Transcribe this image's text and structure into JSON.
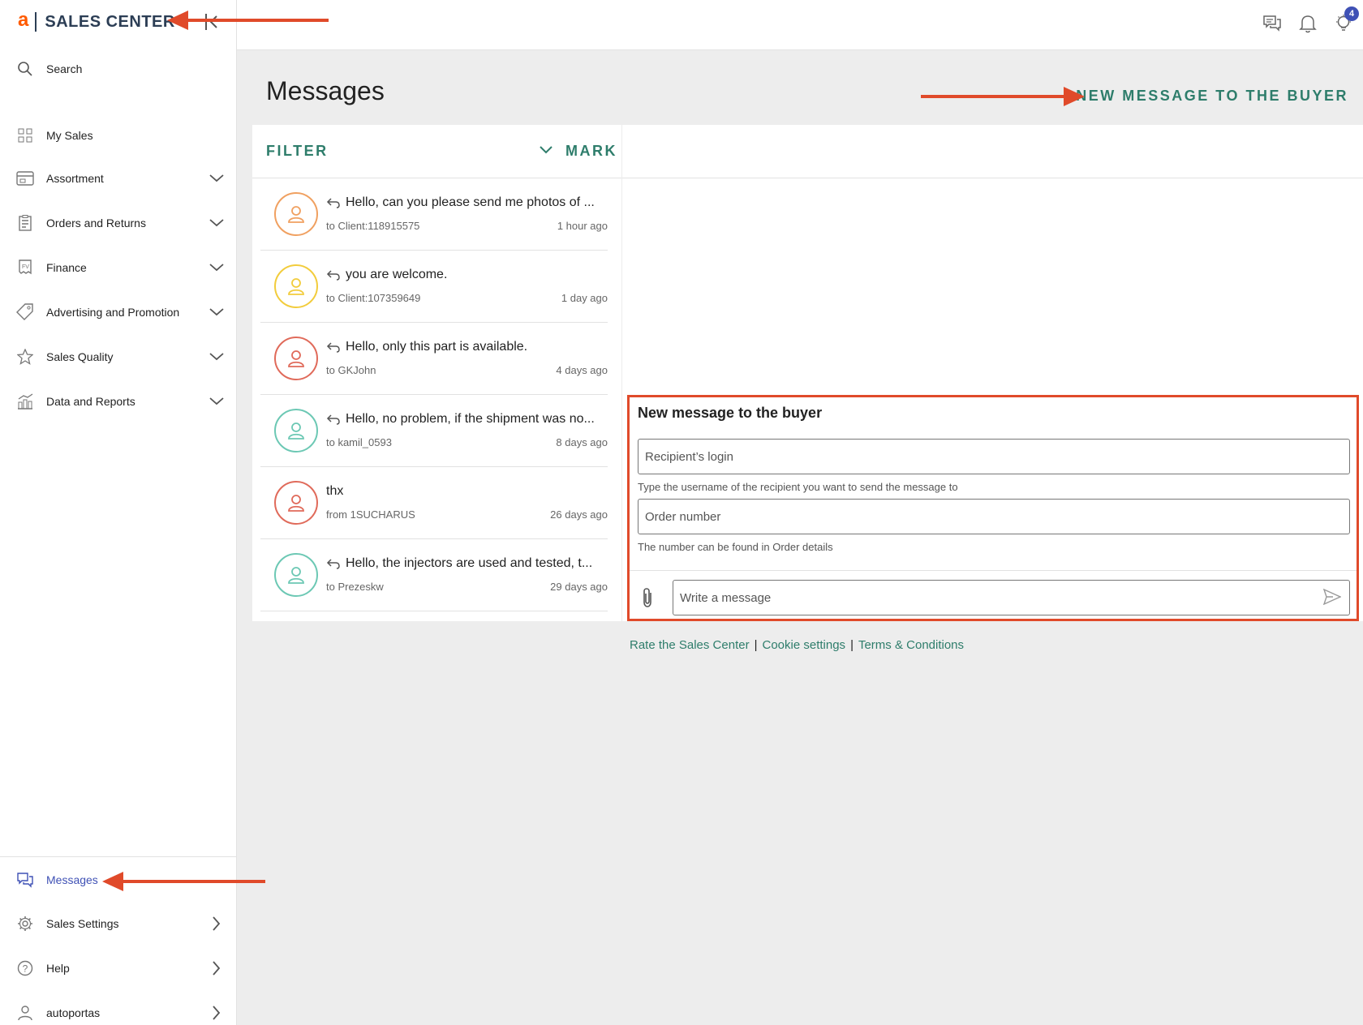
{
  "brand": {
    "logo_letter": "a",
    "name": "SALES CENTER",
    "accent": "#ff5a00",
    "primary": "#2c3e55"
  },
  "sidebar": {
    "search_label": "Search",
    "items": [
      {
        "label": "My Sales",
        "icon": "grid-icon",
        "expandable": false
      },
      {
        "label": "Assortment",
        "icon": "storefront-icon",
        "expandable": true
      },
      {
        "label": "Orders and Returns",
        "icon": "clipboard-icon",
        "expandable": true
      },
      {
        "label": "Finance",
        "icon": "invoice-icon",
        "expandable": true
      },
      {
        "label": "Advertising and Promotion",
        "icon": "tag-icon",
        "expandable": true
      },
      {
        "label": "Sales Quality",
        "icon": "star-icon",
        "expandable": true
      },
      {
        "label": "Data and Reports",
        "icon": "chart-icon",
        "expandable": true
      }
    ],
    "bottom_items": [
      {
        "label": "Messages",
        "icon": "chat-icon",
        "active": true
      },
      {
        "label": "Sales Settings",
        "icon": "gear-icon",
        "active": false
      },
      {
        "label": "Help",
        "icon": "help-icon",
        "active": false
      },
      {
        "label": "autoportas",
        "icon": "user-icon",
        "active": false
      }
    ]
  },
  "topbar": {
    "icons": [
      "messages-icon",
      "bell-icon",
      "lightbulb-icon"
    ],
    "badge_count": "4"
  },
  "main": {
    "title": "Messages",
    "new_message_link": "NEW MESSAGE TO THE BUYER",
    "filter_label": "FILTER",
    "mark_label": "MARK"
  },
  "conversations": [
    {
      "preview": "Hello, can you please send me photos of ...",
      "meta": "to Client:118915575",
      "time": "1 hour ago",
      "reply": true,
      "color": "#f0a060"
    },
    {
      "preview": "you are welcome.",
      "meta": "to Client:107359649",
      "time": "1 day ago",
      "reply": true,
      "color": "#f2cc3c"
    },
    {
      "preview": "Hello, only this part is available.",
      "meta": "to GKJohn",
      "time": "4 days ago",
      "reply": true,
      "color": "#e06a5a"
    },
    {
      "preview": "Hello, no problem, if the shipment was no...",
      "meta": "to kamil_0593",
      "time": "8 days ago",
      "reply": true,
      "color": "#6cc8b4"
    },
    {
      "preview": "thx",
      "meta": "from 1SUCHARUS",
      "time": "26 days ago",
      "reply": false,
      "color": "#e06a5a"
    },
    {
      "preview": "Hello, the injectors are used and tested, t...",
      "meta": "to Prezeskw",
      "time": "29 days ago",
      "reply": true,
      "color": "#6cc8b4"
    }
  ],
  "form": {
    "title": "New message to the buyer",
    "recipient_placeholder": "Recipient’s login",
    "recipient_hint": "Type the username of the recipient you want to send the message to",
    "order_placeholder": "Order number",
    "order_hint": "The number can be found in Order details",
    "message_placeholder": "Write a message"
  },
  "footer": {
    "links": [
      "Rate the Sales Center",
      "Cookie settings",
      "Terms & Conditions"
    ]
  },
  "colors": {
    "link_green": "#2e7d6b",
    "highlight_red": "#e04a2a",
    "active_blue": "#3f51b5"
  }
}
